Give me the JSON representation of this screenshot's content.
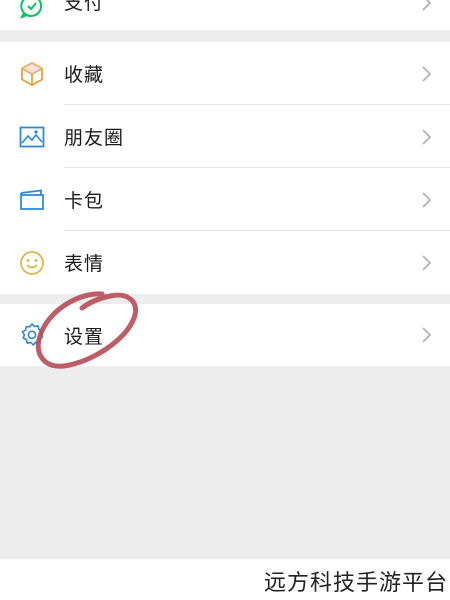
{
  "menu": {
    "top_item": {
      "label": "支付",
      "icon": "pay-icon"
    },
    "items": [
      {
        "label": "收藏",
        "icon": "cube-favorites-icon",
        "color": "#e6a23c"
      },
      {
        "label": "朋友圈",
        "icon": "image-icon",
        "color": "#2e8ad8"
      },
      {
        "label": "卡包",
        "icon": "card-wallet-icon",
        "color": "#2e8ad8"
      },
      {
        "label": "表情",
        "icon": "smiley-icon",
        "color": "#e0b44a"
      }
    ],
    "settings_item": {
      "label": "设置",
      "icon": "gear-icon",
      "color": "#2e8ad8"
    }
  },
  "annotation": {
    "type": "hand-drawn-circle",
    "color": "#b64b55"
  },
  "watermark": "远方科技手游平台",
  "colors": {
    "background": "#ededed",
    "row_bg": "#ffffff",
    "text": "#1b1b1b",
    "chevron": "#b3b3b3",
    "pay_green": "#07c160"
  }
}
